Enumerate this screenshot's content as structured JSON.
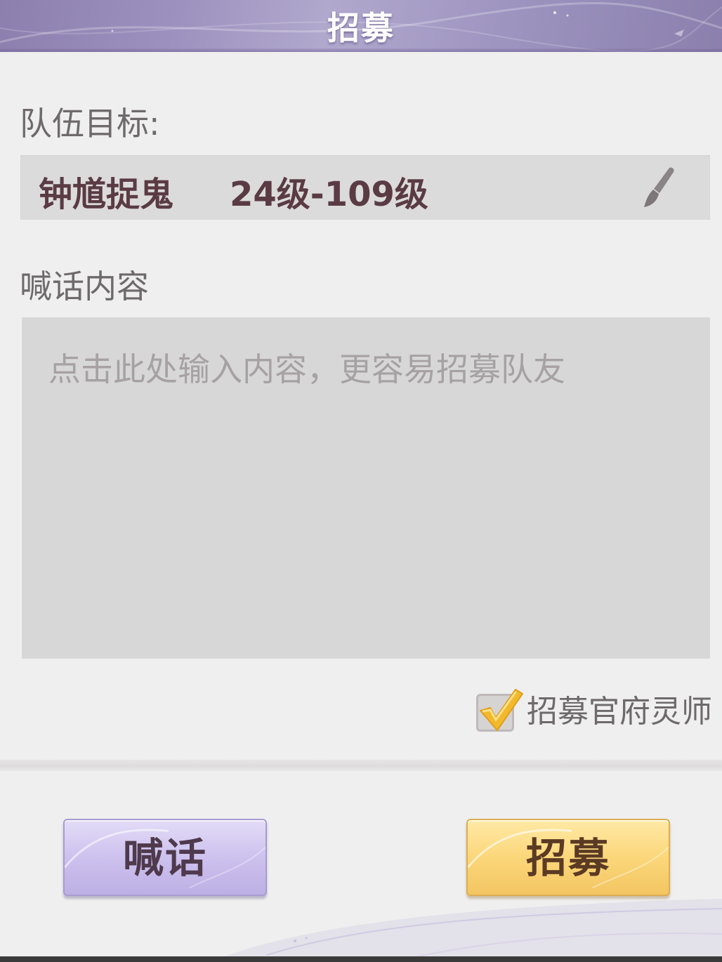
{
  "dialog": {
    "title": "招募"
  },
  "team_goal": {
    "label": "队伍目标:",
    "activity": "钟馗捉鬼",
    "level_range": "24级-109级",
    "edit_icon": "brush-icon"
  },
  "shout": {
    "label": "喊话内容",
    "placeholder": "点击此处输入内容，更容易招募队友",
    "value": ""
  },
  "official_recruit": {
    "label": "招募官府灵师",
    "checked": true
  },
  "buttons": {
    "shout_label": "喊话",
    "recruit_label": "招募"
  },
  "colors": {
    "title_bar": "#9d92bf",
    "panel_bg": "#efefef",
    "input_bg": "#dcdbdc",
    "text_dark": "#5a3b44",
    "shout_button": "#cdc1ee",
    "recruit_button": "#fbd77a",
    "check_mark": "#f2b92c"
  }
}
